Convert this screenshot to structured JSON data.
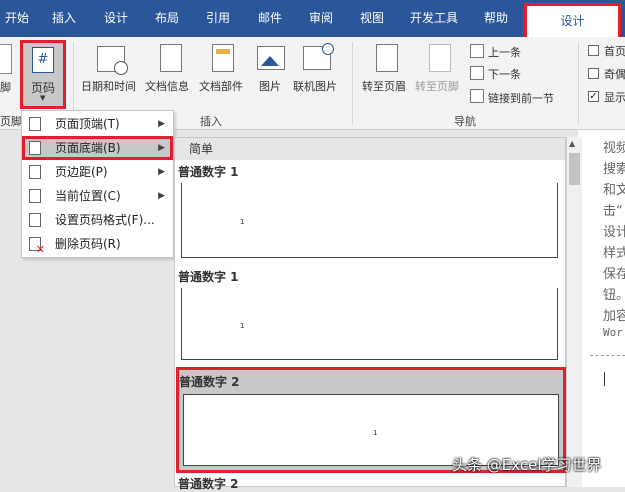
{
  "tabs": {
    "home": "开始",
    "insert": "插入",
    "design": "设计",
    "layout": "布局",
    "references": "引用",
    "mailings": "邮件",
    "review": "审阅",
    "view": "视图",
    "developer": "开发工具",
    "help": "帮助",
    "hf_design": "设计"
  },
  "ribbon": {
    "footer_label": "脚",
    "footer_group_partial": "页脚",
    "page_number_label": "页码",
    "date_time": "日期和时间",
    "doc_info": "文档信息",
    "quick_parts": "文档部件",
    "pictures": "图片",
    "online_pictures": "联机图片",
    "insert_group": "插入",
    "goto_header": "转至页眉",
    "goto_footer": "转至页脚",
    "previous": "上一条",
    "next": "下一条",
    "link_previous": "链接到前一节",
    "nav_group": "导航",
    "option_first": "首页",
    "option_oddeven": "奇偶",
    "option_show": "显示"
  },
  "menu": {
    "items": [
      {
        "label": "页面顶端(T)",
        "has_submenu": true
      },
      {
        "label": "页面底端(B)",
        "has_submenu": true
      },
      {
        "label": "页边距(P)",
        "has_submenu": true
      },
      {
        "label": "当前位置(C)",
        "has_submenu": true
      },
      {
        "label": "设置页码格式(F)...",
        "has_submenu": false
      },
      {
        "label": "删除页码(R)",
        "has_submenu": false
      }
    ]
  },
  "gallery": {
    "header": "简单",
    "items": [
      {
        "title": "普通数字 1",
        "number": "1"
      },
      {
        "title": "普通数字 1",
        "number": "1"
      },
      {
        "title": "普通数字 2",
        "number": "1",
        "selected": true
      },
      {
        "title": "普通数字 2",
        "number": ""
      }
    ]
  },
  "document": {
    "lines": [
      "视频",
      "搜索",
      "和文",
      "击“",
      "设计",
      "样式",
      "保存",
      "钮。",
      "加容",
      "Wor"
    ]
  },
  "watermark": "头条 @Excel学习世界",
  "colors": {
    "ribbon_blue": "#2b579a",
    "highlight_red": "#e0202e",
    "hover_gray": "#c8c8c8"
  }
}
